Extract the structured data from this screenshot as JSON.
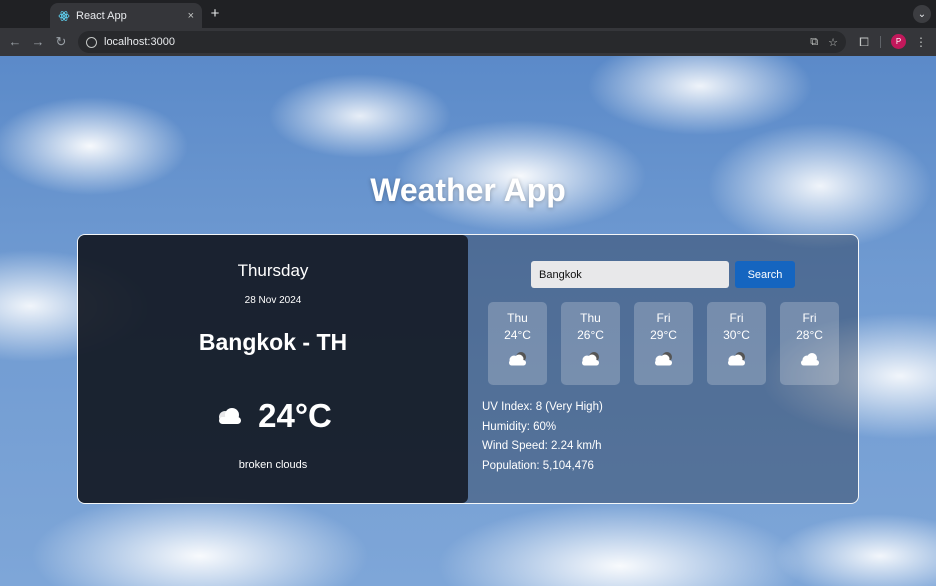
{
  "browser": {
    "tab_title": "React App",
    "tab_close": "×",
    "new_tab": "+",
    "url": "localhost:3000",
    "profile_initial": "P"
  },
  "app": {
    "title": "Weather App"
  },
  "current": {
    "day": "Thursday",
    "date": "28 Nov 2024",
    "city": "Bangkok - TH",
    "temp": "24°C",
    "condition": "broken clouds",
    "icon": "cloud-icon"
  },
  "search": {
    "value": "Bangkok",
    "button_label": "Search"
  },
  "forecast": [
    {
      "day": "Thu",
      "temp": "24°C",
      "icon": "cloud-dark-icon"
    },
    {
      "day": "Thu",
      "temp": "26°C",
      "icon": "cloud-dark-icon"
    },
    {
      "day": "Fri",
      "temp": "29°C",
      "icon": "cloud-dark-icon"
    },
    {
      "day": "Fri",
      "temp": "30°C",
      "icon": "cloud-dark-icon"
    },
    {
      "day": "Fri",
      "temp": "28°C",
      "icon": "cloud-icon"
    }
  ],
  "details": {
    "uv": "UV Index: 8 (Very High)",
    "humidity": "Humidity: 60%",
    "wind": "Wind Speed: 2.24 km/h",
    "population": "Population: 5,104,476"
  },
  "colors": {
    "search_button": "#1565c0",
    "left_panel": "#12161f"
  }
}
